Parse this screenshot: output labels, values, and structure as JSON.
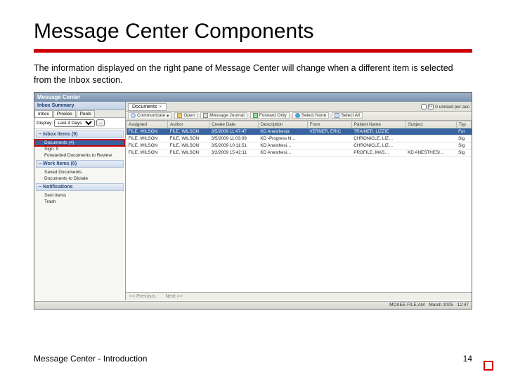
{
  "slide": {
    "title": "Message Center Components",
    "description": "The information displayed on the right pane of Message Center will change when a different item is selected from the Inbox section.",
    "footer_left": "Message Center - Introduction",
    "footer_right": "14"
  },
  "window": {
    "title": "Message Center",
    "left_header": "Inbox Summary",
    "tabs": {
      "t0": "Inbox",
      "t1": "Proxies",
      "t2": "Pools"
    },
    "display_label": "Display:",
    "display_value": "Last 4 Days",
    "ellipsis": "...",
    "sections": {
      "inbox": "Inbox Items (9)",
      "work": "Work Items (0)",
      "notif": "Notifications"
    },
    "inbox_items": {
      "documents": "Documents (4)",
      "sign": "Sign: 0",
      "forwarded": "Forwarded Documents to Review"
    },
    "work_items": {
      "saved": "Saved Documents",
      "dictate": "Documents to Dictate"
    },
    "notif_items": {
      "sent": "Sent Items",
      "trash": "Trash"
    },
    "rp_tab": "Documents",
    "unread_label": "0 unread per acc",
    "toolbar": {
      "communicate": "Communicate",
      "open": "Open",
      "msgjournal": "Message Journal",
      "forward": "Forward Only",
      "selectnone": "Select None",
      "selectall": "Select All"
    },
    "cols": {
      "assigned": "Assigned",
      "author": "Author",
      "create": "Create Date",
      "desc": "Description",
      "from": "From",
      "patient": "Patient Name",
      "subject": "Subject",
      "type": "Typ"
    },
    "rows": [
      {
        "assigned": "FILE, WILSON",
        "author": "FILE, WILSON",
        "create": "3/5/2009 11:47:47",
        "desc": "KD Anesthesia",
        "from": "VERNER, ERIC",
        "patient": "TRAINER, LIZZIE",
        "subject": "",
        "type": "For"
      },
      {
        "assigned": "FILE, WILSON",
        "author": "FILE, WILSON",
        "create": "3/5/2009 11:03:09",
        "desc": "KD -Progress N…",
        "from": "",
        "patient": "CHRONICLE, LIZ…",
        "subject": "",
        "type": "Sig"
      },
      {
        "assigned": "FILE, WILSON",
        "author": "FILE, WILSON",
        "create": "3/5/2009 10:11:51",
        "desc": "KD Anesthesi…",
        "from": "",
        "patient": "CHRONICLE, LIZ…",
        "subject": "",
        "type": "Sig"
      },
      {
        "assigned": "FILE, WILSON",
        "author": "FILE, WILSON",
        "create": "3/2/2009 15:42:11",
        "desc": "KD Anesthesi…",
        "from": "",
        "patient": "PROFILE, MAS…",
        "subject": "KD ANESTHESI…",
        "type": "Sig"
      }
    ],
    "pager": {
      "prev": "<< Previous",
      "next": "Next >>"
    },
    "status": {
      "user": "MCKEE FILE,AM",
      "date": "March 2005",
      "time": "12:47"
    }
  }
}
